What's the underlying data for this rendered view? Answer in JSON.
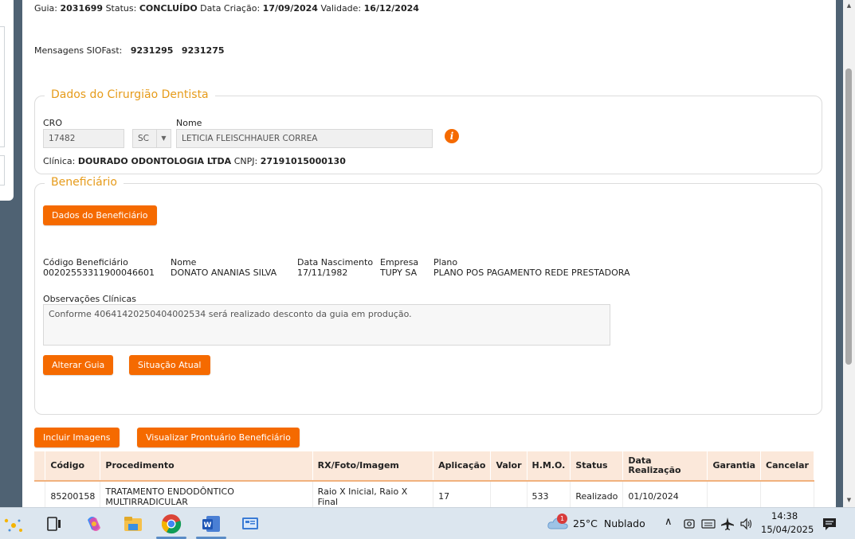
{
  "header": {
    "guia_label": "Guia:",
    "guia_value": "2031699",
    "status_label": "Status:",
    "status_value": "CONCLUÍDO",
    "criacao_label": "Data Criação:",
    "criacao_value": "17/09/2024",
    "validade_label": "Validade:",
    "validade_value": "16/12/2024",
    "mensagens_label": "Mensagens SIOFast:",
    "mensagem_1": "9231295",
    "mensagem_2": "9231275"
  },
  "dentista": {
    "legend": "Dados do Cirurgião Dentista",
    "cro_label": "CRO",
    "cro_value": "17482",
    "uf_value": "SC",
    "nome_label": "Nome",
    "nome_value": "LETICIA FLEISCHHAUER CORREA",
    "clinica_label": "Clínica:",
    "clinica_value": "DOURADO ODONTOLOGIA LTDA",
    "cnpj_label": "CNPJ:",
    "cnpj_value": "27191015000130"
  },
  "beneficiario": {
    "legend": "Beneficiário",
    "dados_button": "Dados do Beneficiário",
    "codigo_label": "Código Beneficiário",
    "codigo_value": "00202553311900046601",
    "nome_label": "Nome",
    "nome_value": "DONATO ANANIAS SILVA",
    "nascimento_label": "Data Nascimento",
    "nascimento_value": "17/11/1982",
    "empresa_label": "Empresa",
    "empresa_value": "TUPY SA",
    "plano_label": "Plano",
    "plano_value": "PLANO POS PAGAMENTO REDE PRESTADORA",
    "obs_label": "Observações Clínicas",
    "obs_value": "Conforme 40641420250404002534 será realizado desconto da guia em produção.",
    "alterar_button": "Alterar Guia",
    "situacao_button": "Situação Atual"
  },
  "actions": {
    "incluir_imagens": "Incluir Imagens",
    "visualizar_prontuario": "Visualizar Prontuário Beneficiário"
  },
  "table": {
    "headers": [
      "Código",
      "Procedimento",
      "RX/Foto/Imagem",
      "Aplicação",
      "Valor",
      "H.M.O.",
      "Status",
      "Data Realização",
      "Garantia",
      "Cancelar"
    ],
    "rows": [
      {
        "codigo": "85200158",
        "procedimento": "TRATAMENTO ENDODÔNTICO MULTIRRADICULAR",
        "rx": "Raio X Inicial, Raio X Final",
        "aplicacao": "17",
        "valor": "",
        "hmo": "533",
        "status": "Realizado",
        "data": "01/10/2024",
        "garantia": "",
        "cancelar": ""
      }
    ]
  },
  "taskbar": {
    "weather_temp": "25°C",
    "weather_desc": "Nublado",
    "weather_badge": "1",
    "time": "14:38",
    "date": "15/04/2025"
  },
  "colors": {
    "accent": "#f56a00",
    "legend": "#e69b1a",
    "table_header": "#fbe8da"
  }
}
